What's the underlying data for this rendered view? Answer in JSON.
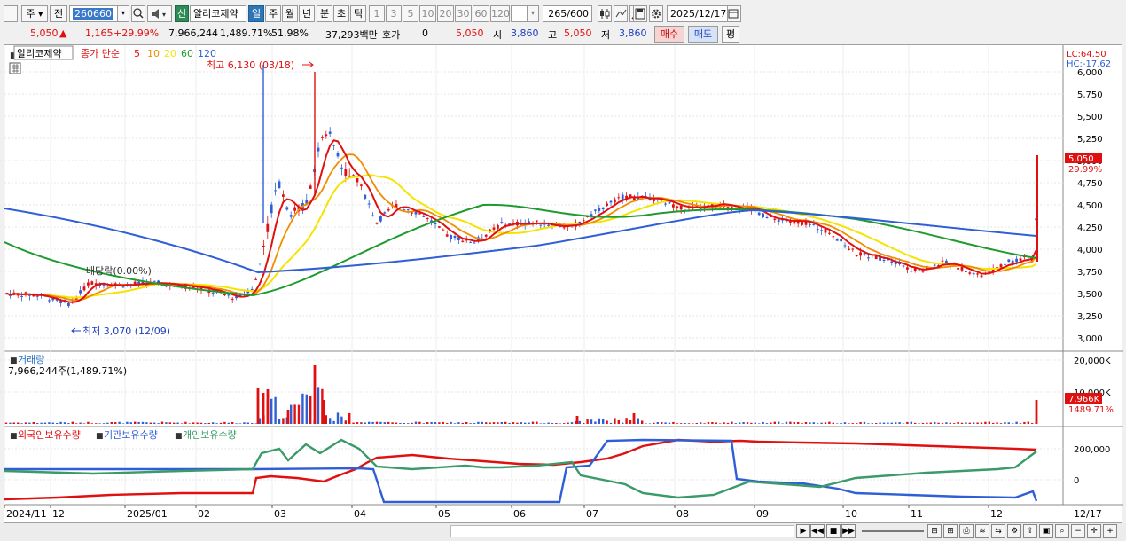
{
  "toolbar": {
    "market": "주",
    "prev": "전",
    "code": "260660",
    "new_badge": "신",
    "stock_name": "알리코제약",
    "periods": [
      "일",
      "주",
      "월",
      "년",
      "분",
      "초",
      "틱"
    ],
    "active_period": "일",
    "intervals": [
      "1",
      "3",
      "5",
      "10",
      "20",
      "30",
      "60",
      "120"
    ],
    "count": "265",
    "count_total": "/600",
    "date": "2025/12/17"
  },
  "quote": {
    "price": "5,050",
    "change": "1,165",
    "change_pct": "+29.99%",
    "volume": "7,966,244",
    "volume_pct": "1,489.71%",
    "turnover_pct": "51.98%",
    "amount": "37,293백만",
    "hoga_label": "호가",
    "hoga_value": "0",
    "hoga_price": "5,050",
    "open_label": "시",
    "open": "3,860",
    "high_label": "고",
    "high": "5,050",
    "low_label": "저",
    "low": "3,860",
    "buy": "매수",
    "sell": "매도",
    "eval": "평"
  },
  "price_panel": {
    "title": "알리코제약",
    "legend_prefix": "종가 단순",
    "ma_labels": [
      "5",
      "10",
      "20",
      "60",
      "120"
    ],
    "high_note": "최고 6,130 (03/18)",
    "low_note": "최저 3,070 (12/09)",
    "dividend_note": "배당락(0.00%)",
    "lc": "LC:64.50",
    "hc": "HC:-17.62",
    "current_label": "5,050",
    "current_pct": "29.99%",
    "y_ticks": [
      "6,000",
      "5,750",
      "5,500",
      "5,250",
      "5,000",
      "4,750",
      "4,500",
      "4,250",
      "4,000",
      "3,750",
      "3,500",
      "3,250",
      "3,000"
    ]
  },
  "volume_panel": {
    "title": "거래량",
    "value": "7,966,244주(1,489.71%)",
    "y_ticks": [
      "20,000K",
      "10,000K"
    ],
    "current_label": "7,966K",
    "current_pct": "1489.71%"
  },
  "holding_panel": {
    "legend": [
      "외국인보유수량",
      "기관보유수량",
      "개인보유수량"
    ],
    "y_ticks": [
      "200,000",
      "0"
    ]
  },
  "x_axis": [
    "2024/11",
    "12",
    "2025/01",
    "02",
    "03",
    "04",
    "05",
    "06",
    "07",
    "08",
    "09",
    "10",
    "11",
    "12"
  ],
  "x_axis_right": "12/17",
  "colors": {
    "ma5": "#e01010",
    "ma10": "#f08c00",
    "ma20": "#f5e400",
    "ma60": "#1f9a2f",
    "ma120": "#2f5fd6",
    "foreign": "#e01010",
    "institution": "#2f5fd6",
    "individual": "#3a9a6a"
  }
}
